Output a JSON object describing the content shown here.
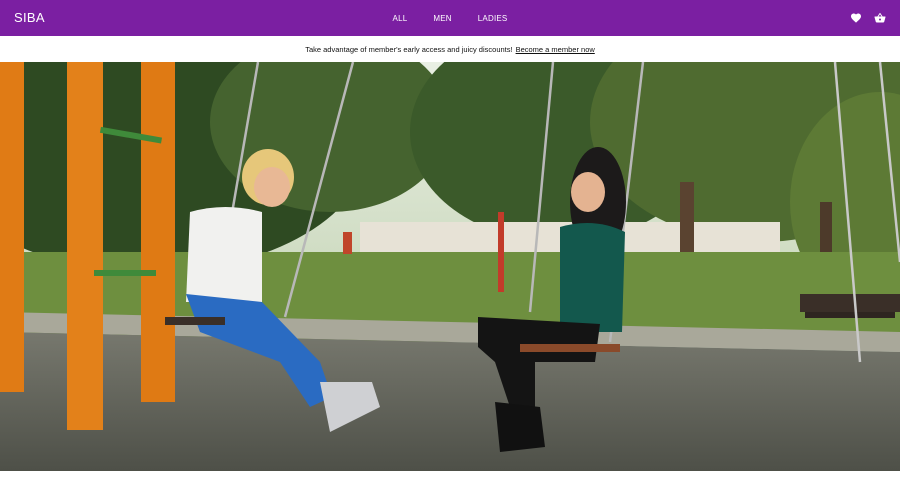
{
  "header": {
    "brand": "SIBA",
    "nav": [
      "ALL",
      "MEN",
      "LADIES"
    ],
    "icons": [
      "heart-icon",
      "basket-icon"
    ],
    "bg_color": "#7b1fa2",
    "text_color": "#ffffff"
  },
  "promo": {
    "text": "Take advantage of member's early access and juicy discounts!",
    "link_text": "Become a member now"
  },
  "hero": {
    "image_subject": "Two women sitting on playground swings facing each other in a park"
  }
}
